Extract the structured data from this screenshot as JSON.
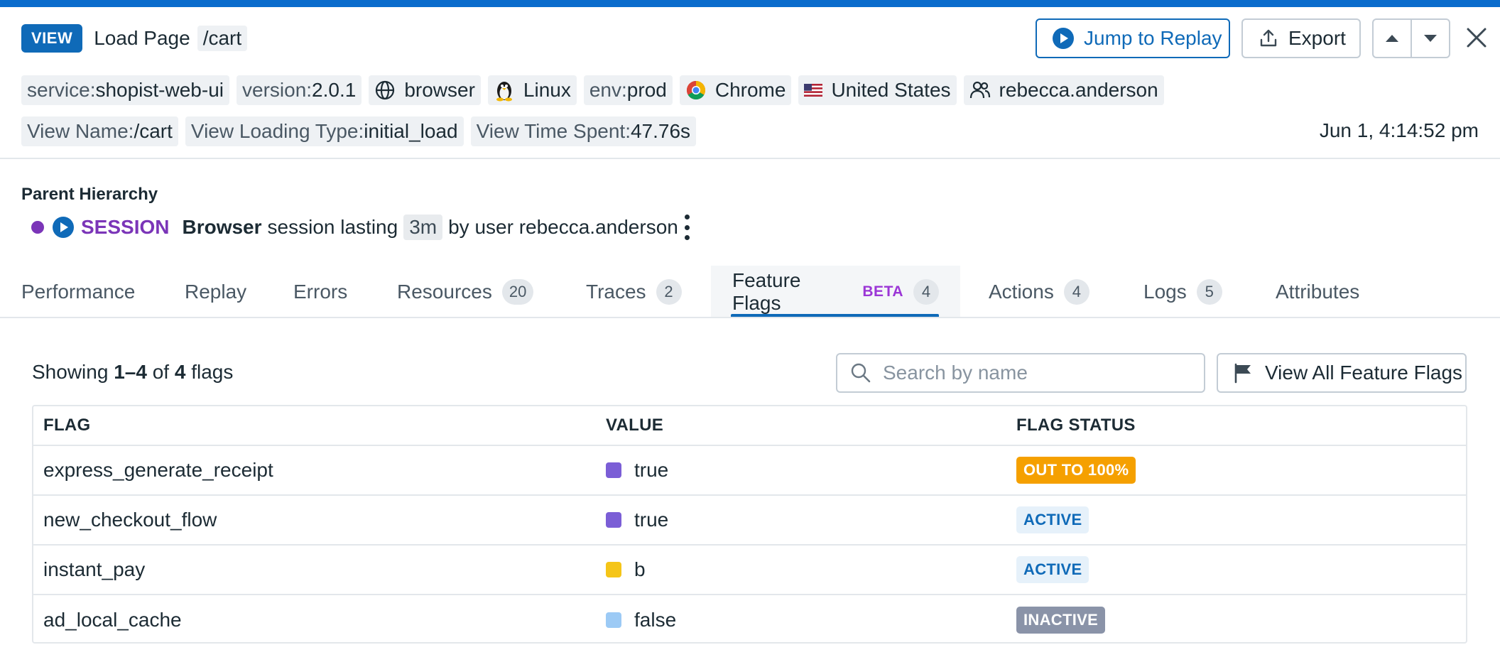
{
  "header": {
    "view_badge": "VIEW",
    "title": "Load Page",
    "path": "/cart",
    "jump_label": "Jump to Replay",
    "export_label": "Export"
  },
  "tags_row1": [
    {
      "key": "service:",
      "value": "shopist-web-ui",
      "icon": ""
    },
    {
      "key": "version:",
      "value": "2.0.1",
      "icon": ""
    },
    {
      "key": "",
      "value": "browser",
      "icon": "globe-icon"
    },
    {
      "key": "",
      "value": "Linux",
      "icon": "linux-penguin-icon"
    },
    {
      "key": "env:",
      "value": "prod",
      "icon": ""
    },
    {
      "key": "",
      "value": "Chrome",
      "icon": "chrome-icon"
    },
    {
      "key": "",
      "value": "United States",
      "icon": "us-flag-icon"
    },
    {
      "key": "",
      "value": "rebecca.anderson",
      "icon": "user-icon"
    }
  ],
  "tags_row2": [
    {
      "key": "View Name:",
      "value": "/cart"
    },
    {
      "key": "View Loading Type:",
      "value": "initial_load"
    },
    {
      "key": "View Time Spent:",
      "value": "47.76s"
    }
  ],
  "timestamp": "Jun 1, 4:14:52 pm",
  "parent": {
    "title": "Parent Hierarchy",
    "session_label": "SESSION",
    "browser_label": "Browser",
    "text1": "session lasting",
    "duration": "3m",
    "text2": "by user rebecca.anderson"
  },
  "tabs": [
    {
      "label": "Performance",
      "count": ""
    },
    {
      "label": "Replay",
      "count": ""
    },
    {
      "label": "Errors",
      "count": ""
    },
    {
      "label": "Resources",
      "count": "20"
    },
    {
      "label": "Traces",
      "count": "2"
    },
    {
      "label": "Feature Flags",
      "count": "4",
      "beta": "BETA"
    },
    {
      "label": "Actions",
      "count": "4"
    },
    {
      "label": "Logs",
      "count": "5"
    },
    {
      "label": "Attributes",
      "count": ""
    }
  ],
  "flags": {
    "showing_prefix": "Showing",
    "showing_range": "1–4",
    "showing_of": "of",
    "showing_total": "4",
    "showing_suffix": "flags",
    "search_placeholder": "Search by name",
    "view_all_label": "View All Feature Flags",
    "columns": [
      "FLAG",
      "VALUE",
      "FLAG STATUS"
    ],
    "rows": [
      {
        "flag": "express_generate_receipt",
        "value": "true",
        "swatch": "#7b5ed6",
        "status": "OUT TO 100%",
        "status_kind": "out"
      },
      {
        "flag": "new_checkout_flow",
        "value": "true",
        "swatch": "#7b5ed6",
        "status": "ACTIVE",
        "status_kind": "active"
      },
      {
        "flag": "instant_pay",
        "value": "b",
        "swatch": "#f5c518",
        "status": "ACTIVE",
        "status_kind": "active"
      },
      {
        "flag": "ad_local_cache",
        "value": "false",
        "swatch": "#9ccaf5",
        "status": "INACTIVE",
        "status_kind": "inactive"
      }
    ]
  },
  "colors": {
    "accent": "#0f6ab8",
    "session_purple": "#7b35b8",
    "beta_purple": "#9b36d6",
    "status_out": "#f5a000",
    "status_inactive": "#8a93a8"
  }
}
